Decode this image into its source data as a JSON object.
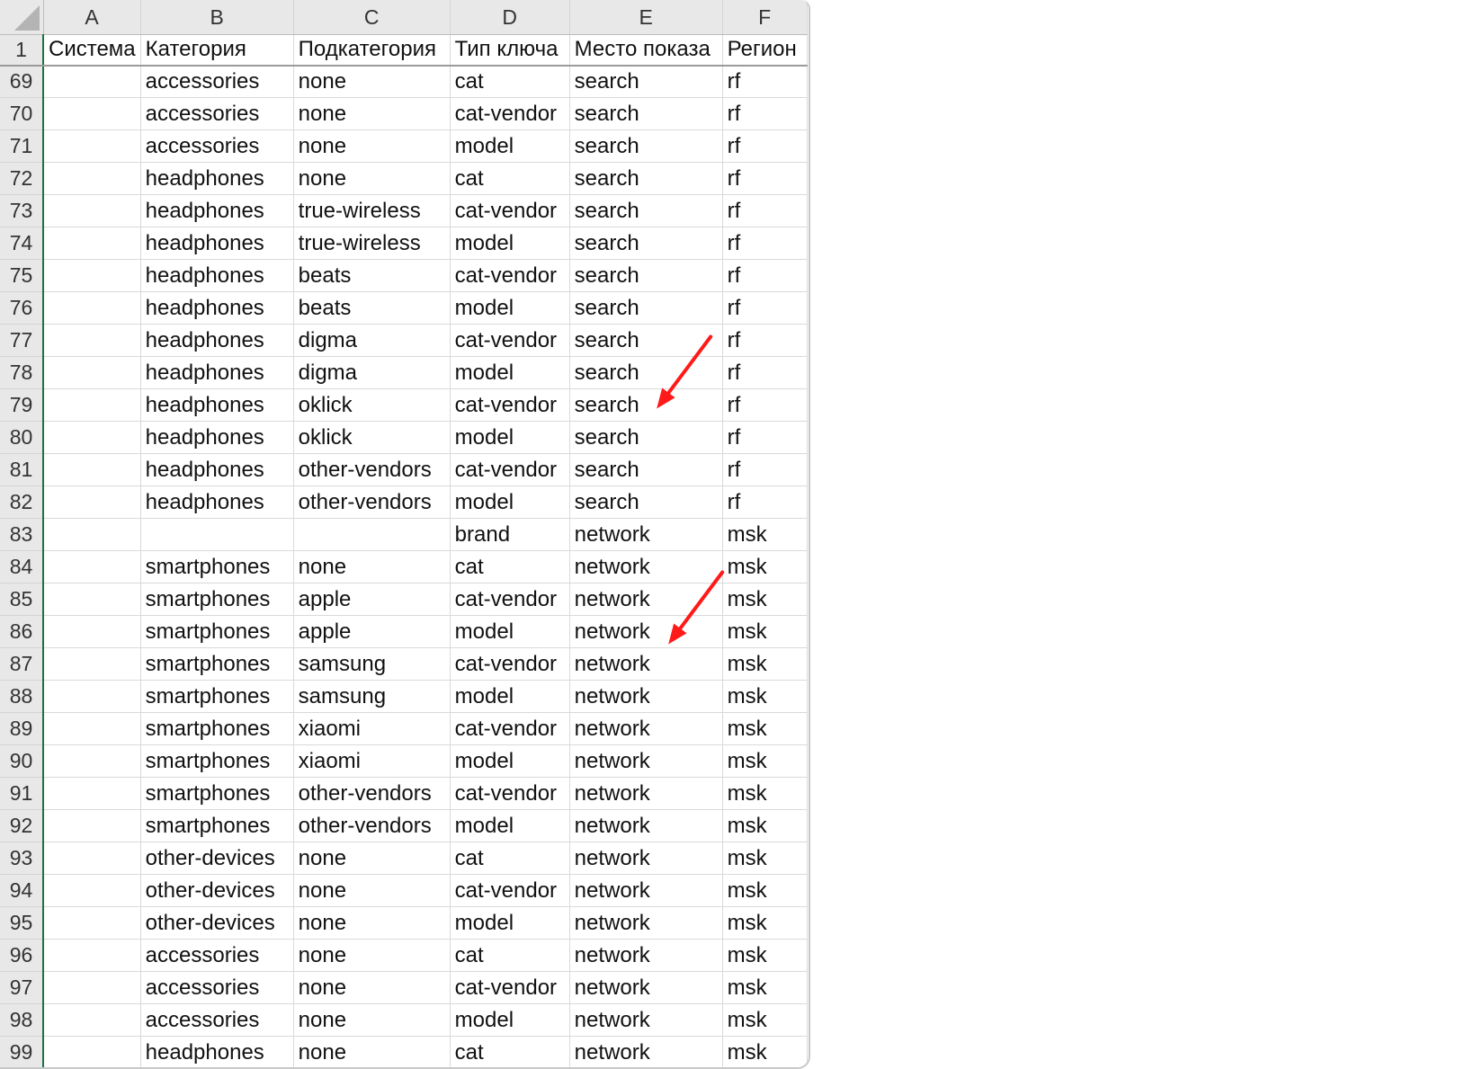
{
  "columns": [
    "A",
    "B",
    "C",
    "D",
    "E",
    "F"
  ],
  "header_row": {
    "number": "1",
    "cells": [
      "Система",
      "Категория",
      "Подкатегория",
      "Тип ключа",
      "Место показа",
      "Регион"
    ]
  },
  "rows": [
    {
      "n": "69",
      "cells": [
        "",
        "accessories",
        "none",
        "cat",
        "search",
        "rf"
      ]
    },
    {
      "n": "70",
      "cells": [
        "",
        "accessories",
        "none",
        "cat-vendor",
        "search",
        "rf"
      ]
    },
    {
      "n": "71",
      "cells": [
        "",
        "accessories",
        "none",
        "model",
        "search",
        "rf"
      ]
    },
    {
      "n": "72",
      "cells": [
        "",
        "headphones",
        "none",
        "cat",
        "search",
        "rf"
      ]
    },
    {
      "n": "73",
      "cells": [
        "",
        "headphones",
        "true-wireless",
        "cat-vendor",
        "search",
        "rf"
      ]
    },
    {
      "n": "74",
      "cells": [
        "",
        "headphones",
        "true-wireless",
        "model",
        "search",
        "rf"
      ]
    },
    {
      "n": "75",
      "cells": [
        "",
        "headphones",
        "beats",
        "cat-vendor",
        "search",
        "rf"
      ]
    },
    {
      "n": "76",
      "cells": [
        "",
        "headphones",
        "beats",
        "model",
        "search",
        "rf"
      ]
    },
    {
      "n": "77",
      "cells": [
        "",
        "headphones",
        "digma",
        "cat-vendor",
        "search",
        "rf"
      ]
    },
    {
      "n": "78",
      "cells": [
        "",
        "headphones",
        "digma",
        "model",
        "search",
        "rf"
      ]
    },
    {
      "n": "79",
      "cells": [
        "",
        "headphones",
        "oklick",
        "cat-vendor",
        "search",
        "rf"
      ]
    },
    {
      "n": "80",
      "cells": [
        "",
        "headphones",
        "oklick",
        "model",
        "search",
        "rf"
      ]
    },
    {
      "n": "81",
      "cells": [
        "",
        "headphones",
        "other-vendors",
        "cat-vendor",
        "search",
        "rf"
      ]
    },
    {
      "n": "82",
      "cells": [
        "",
        "headphones",
        "other-vendors",
        "model",
        "search",
        "rf"
      ]
    },
    {
      "n": "83",
      "cells": [
        "",
        "",
        "",
        "brand",
        "network",
        "msk"
      ]
    },
    {
      "n": "84",
      "cells": [
        "",
        "smartphones",
        "none",
        "cat",
        "network",
        "msk"
      ]
    },
    {
      "n": "85",
      "cells": [
        "",
        "smartphones",
        "apple",
        "cat-vendor",
        "network",
        "msk"
      ]
    },
    {
      "n": "86",
      "cells": [
        "",
        "smartphones",
        "apple",
        "model",
        "network",
        "msk"
      ]
    },
    {
      "n": "87",
      "cells": [
        "",
        "smartphones",
        "samsung",
        "cat-vendor",
        "network",
        "msk"
      ]
    },
    {
      "n": "88",
      "cells": [
        "",
        "smartphones",
        "samsung",
        "model",
        "network",
        "msk"
      ]
    },
    {
      "n": "89",
      "cells": [
        "",
        "smartphones",
        "xiaomi",
        "cat-vendor",
        "network",
        "msk"
      ]
    },
    {
      "n": "90",
      "cells": [
        "",
        "smartphones",
        "xiaomi",
        "model",
        "network",
        "msk"
      ]
    },
    {
      "n": "91",
      "cells": [
        "",
        "smartphones",
        "other-vendors",
        "cat-vendor",
        "network",
        "msk"
      ]
    },
    {
      "n": "92",
      "cells": [
        "",
        "smartphones",
        "other-vendors",
        "model",
        "network",
        "msk"
      ]
    },
    {
      "n": "93",
      "cells": [
        "",
        "other-devices",
        "none",
        "cat",
        "network",
        "msk"
      ]
    },
    {
      "n": "94",
      "cells": [
        "",
        "other-devices",
        "none",
        "cat-vendor",
        "network",
        "msk"
      ]
    },
    {
      "n": "95",
      "cells": [
        "",
        "other-devices",
        "none",
        "model",
        "network",
        "msk"
      ]
    },
    {
      "n": "96",
      "cells": [
        "",
        "accessories",
        "none",
        "cat",
        "network",
        "msk"
      ]
    },
    {
      "n": "97",
      "cells": [
        "",
        "accessories",
        "none",
        "cat-vendor",
        "network",
        "msk"
      ]
    },
    {
      "n": "98",
      "cells": [
        "",
        "accessories",
        "none",
        "model",
        "network",
        "msk"
      ]
    },
    {
      "n": "99",
      "cells": [
        "",
        "headphones",
        "none",
        "cat",
        "network",
        "msk"
      ]
    }
  ],
  "annotations": {
    "arrow_color": "#ff1a1a",
    "arrows": [
      {
        "points_to_row": "80",
        "points_to_column": "E"
      },
      {
        "points_to_row": "87",
        "points_to_column": "E"
      }
    ]
  },
  "colors": {
    "header_bg": "#e8e8e8",
    "gridline": "#d9d9d9",
    "selection": "#1e7145"
  }
}
